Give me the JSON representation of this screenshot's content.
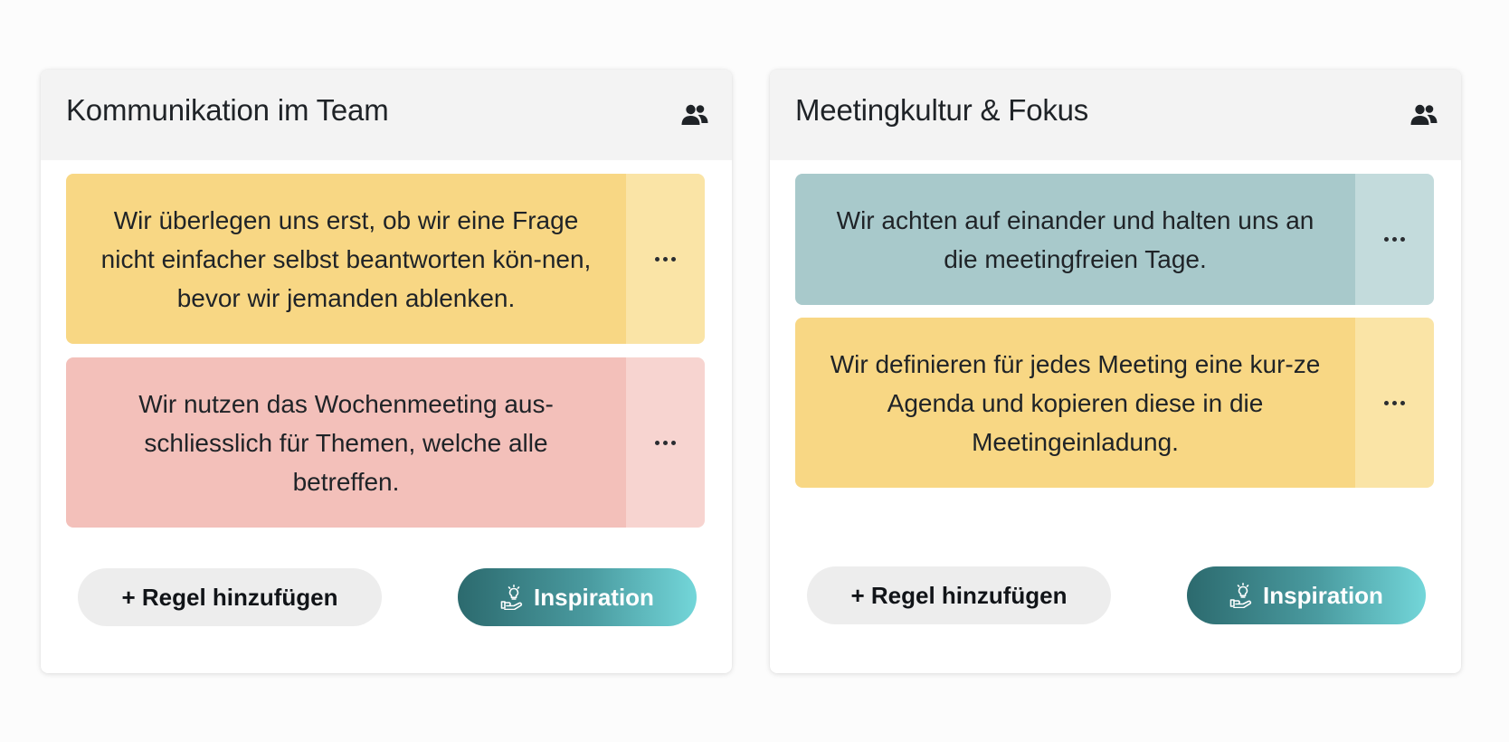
{
  "colors": {
    "yellow": "#f8d784",
    "red": "#f3c0ba",
    "teal": "#a8c9cb",
    "inspiration_gradient": [
      "#2c6a6e",
      "#73d6d9"
    ]
  },
  "cards": [
    {
      "title": "Kommunikation im Team",
      "header_icon": "team-icon",
      "rules": [
        {
          "text": "Wir überlegen uns erst, ob wir eine Frage nicht einfacher selbst beantworten kön-nen, bevor wir jemanden ablenken.",
          "color": "yellow",
          "menu_icon": "more-dots-icon"
        },
        {
          "text": "Wir nutzen das Wochenmeeting aus-schliesslich für Themen, welche alle betreffen.",
          "color": "red",
          "menu_icon": "more-dots-icon"
        }
      ],
      "add_button": "+ Regel hinzufügen",
      "inspiration_button": "Inspiration",
      "inspiration_icon": "lightbulb-hand-icon"
    },
    {
      "title": "Meetingkultur & Fokus",
      "header_icon": "team-icon",
      "rules": [
        {
          "text": "Wir achten auf einander und halten uns an die meetingfreien Tage.",
          "color": "teal",
          "menu_icon": "more-dots-icon"
        },
        {
          "text": "Wir definieren für jedes Meeting eine kur-ze Agenda und kopieren diese in die Meetingeinladung.",
          "color": "yellow",
          "menu_icon": "more-dots-icon"
        }
      ],
      "add_button": "+ Regel hinzufügen",
      "inspiration_button": "Inspiration",
      "inspiration_icon": "lightbulb-hand-icon"
    }
  ]
}
